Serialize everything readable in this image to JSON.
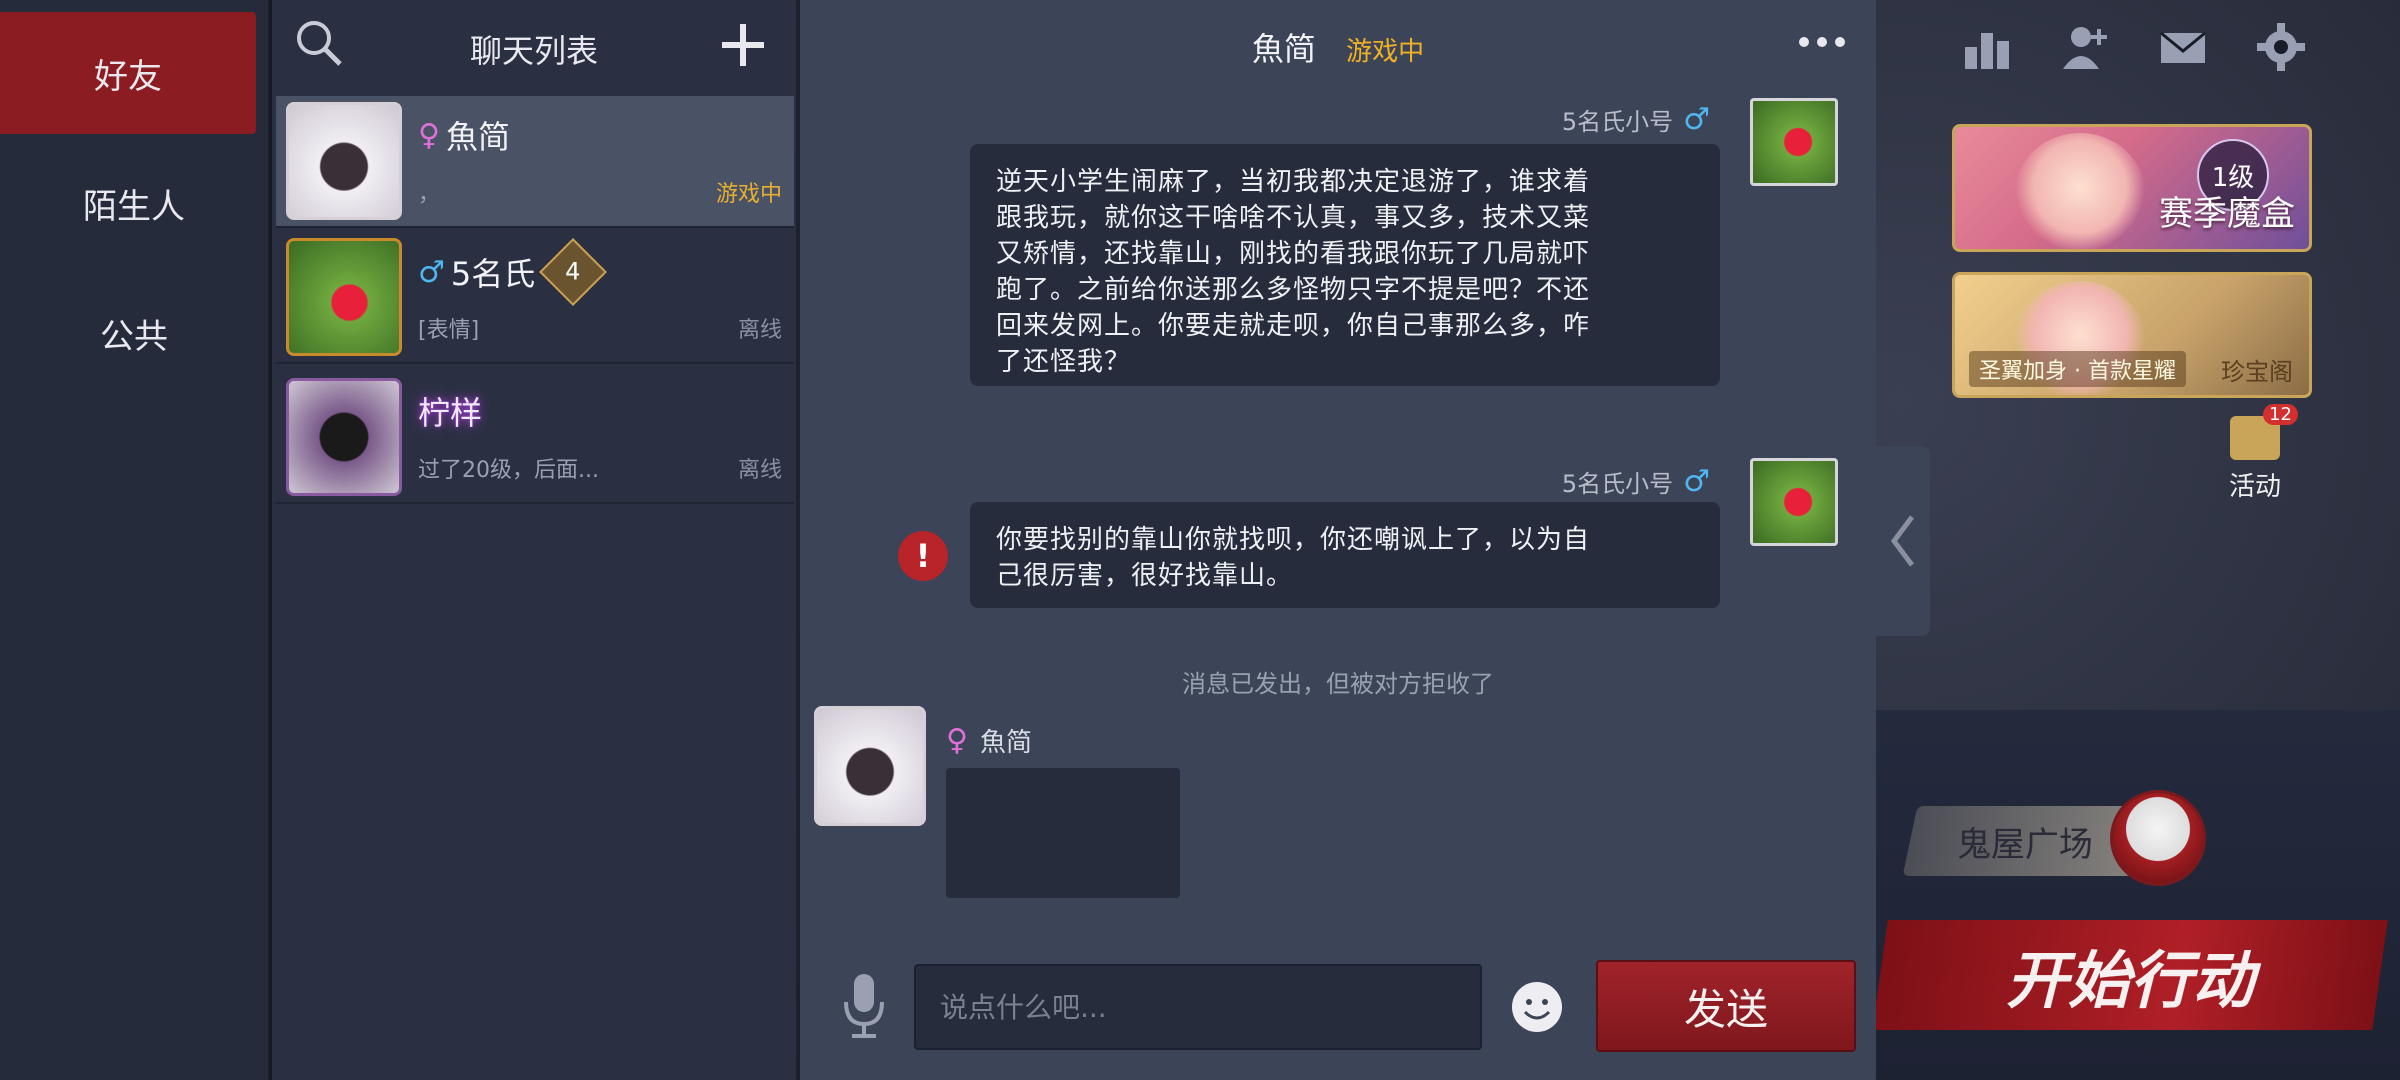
{
  "nav": {
    "items": [
      {
        "label": "好友",
        "active": true
      },
      {
        "label": "陌生人",
        "active": false
      },
      {
        "label": "公共",
        "active": false
      }
    ]
  },
  "list": {
    "title": "聊天列表",
    "friends": [
      {
        "name": "魚简",
        "gender": "♀",
        "message": "，",
        "status": "游戏中",
        "level": ""
      },
      {
        "name": "5名氏",
        "gender": "♂",
        "message": "[表情]",
        "status": "离线",
        "level": "4"
      },
      {
        "name": "柠样",
        "gender": "",
        "message": "过了20级，后面...",
        "status": "离线",
        "level": ""
      }
    ]
  },
  "chat": {
    "title": "魚简",
    "state": "游戏中",
    "messages": [
      {
        "sender": "5名氏小号",
        "gender": "♂",
        "lines": [
          "逆天小学生闹麻了，当初我都决定退游了，谁求着",
          "跟我玩，就你这干啥啥不认真，事又多，技术又菜",
          "又矫情，还找靠山，刚找的看我跟你玩了几局就吓",
          "跑了。之前给你送那么多怪物只字不提是吧？不还",
          "回来发网上。你要走就走呗，你自己事那么多，咋",
          "了还怪我？"
        ]
      },
      {
        "sender": "5名氏小号",
        "gender": "♂",
        "error_mark": "!",
        "lines": [
          "你要找别的靠山你就找呗，你还嘲讽上了，以为自",
          "己很厉害，很好找靠山。"
        ]
      }
    ],
    "system_note": "消息已发出，但被对方拒收了",
    "peer": {
      "name": "魚简",
      "gender": "♀"
    },
    "input_placeholder": "说点什么吧...",
    "send_label": "发送"
  },
  "side": {
    "season_card": "赛季魔盒",
    "season_level": "1级",
    "treasure_sub": "圣翼加身 · 首款星耀",
    "treasure_label": "珍宝阁",
    "activity_label": "活动",
    "activity_count": "12",
    "plaza_label": "鬼屋广场",
    "start_label": "开始行动"
  },
  "colors": {
    "accent_red": "#8b1c21",
    "ingame_yellow": "#f0b024",
    "male_blue": "#4fb6f0",
    "female_pink": "#e070d8"
  }
}
